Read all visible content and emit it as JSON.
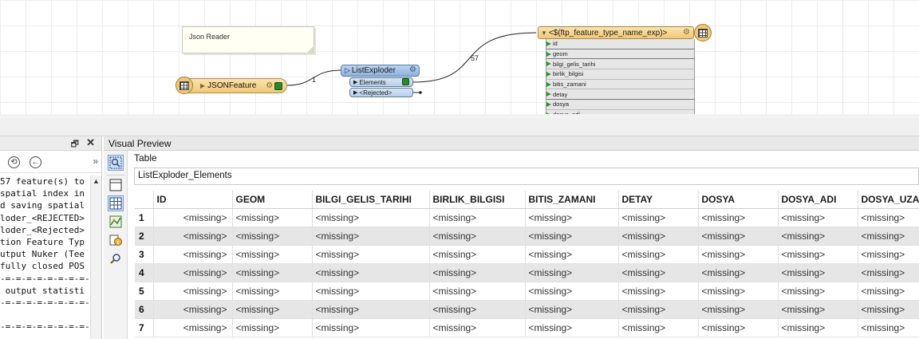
{
  "canvas": {
    "annotation_text": "Json Reader",
    "reader_label": "JSONFeature",
    "transformer": {
      "name": "ListExploder",
      "ports": [
        "Elements",
        "<Rejected>"
      ]
    },
    "writer": {
      "label": "<$(ftp_feature_type_name_exp)>",
      "attributes": [
        "id",
        "geom",
        "bilgi_gelis_tarihi",
        "birlik_bilgisi",
        "bitis_zamani",
        "detay",
        "dosya",
        "dosya_adi"
      ]
    },
    "connection_counts": [
      "1",
      "57"
    ]
  },
  "log_panel": {
    "restore_glyph": "🗗",
    "close_glyph": "✕",
    "more_glyph": "»",
    "back_glyph": "⟲",
    "prev_glyph": "←",
    "lines": [
      "57 feature(s) to",
      "spatial index in",
      "d saving spatial",
      "loder_<REJECTED>",
      "loder_<Rejected>",
      "tion Feature Typ",
      "utput Nuker (Tee",
      "fully closed POS",
      "-=-=-=-=-=-=-=-=-",
      " output statisti",
      "-=-=-=-=-=-=-=-=-",
      "",
      "-=-=-=-=-=-=-=-=-"
    ]
  },
  "visual_preview": {
    "title": "Visual Preview",
    "tab_label": "Table",
    "table_name": "ListExploder_Elements",
    "columns": [
      "ID",
      "GEOM",
      "BILGI_GELIS_TARIHI",
      "BIRLIK_BILGISI",
      "BITIS_ZAMANI",
      "DETAY",
      "DOSYA",
      "DOSYA_ADI",
      "DOSYA_UZAI"
    ],
    "rows": [
      {
        "num": "1",
        "cells": [
          "<missing>",
          "<missing>",
          "<missing>",
          "<missing>",
          "<missing>",
          "<missing>",
          "<missing>",
          "<missing>",
          "<missing>"
        ]
      },
      {
        "num": "2",
        "cells": [
          "<missing>",
          "<missing>",
          "<missing>",
          "<missing>",
          "<missing>",
          "<missing>",
          "<missing>",
          "<missing>",
          "<missing>"
        ]
      },
      {
        "num": "3",
        "cells": [
          "<missing>",
          "<missing>",
          "<missing>",
          "<missing>",
          "<missing>",
          "<missing>",
          "<missing>",
          "<missing>",
          "<missing>"
        ]
      },
      {
        "num": "4",
        "cells": [
          "<missing>",
          "<missing>",
          "<missing>",
          "<missing>",
          "<missing>",
          "<missing>",
          "<missing>",
          "<missing>",
          "<missing>"
        ]
      },
      {
        "num": "5",
        "cells": [
          "<missing>",
          "<missing>",
          "<missing>",
          "<missing>",
          "<missing>",
          "<missing>",
          "<missing>",
          "<missing>",
          "<missing>"
        ]
      },
      {
        "num": "6",
        "cells": [
          "<missing>",
          "<missing>",
          "<missing>",
          "<missing>",
          "<missing>",
          "<missing>",
          "<missing>",
          "<missing>",
          "<missing>"
        ]
      },
      {
        "num": "7",
        "cells": [
          "<missing>",
          "<missing>",
          "<missing>",
          "<missing>",
          "<missing>",
          "<missing>",
          "<missing>",
          "<missing>",
          "<missing>"
        ]
      }
    ]
  },
  "colors": {
    "reader_node": "#f2c877",
    "transformer_node": "#8fb2de",
    "port_green": "#2a9a2a",
    "alt_row": "#e6e6e6"
  }
}
